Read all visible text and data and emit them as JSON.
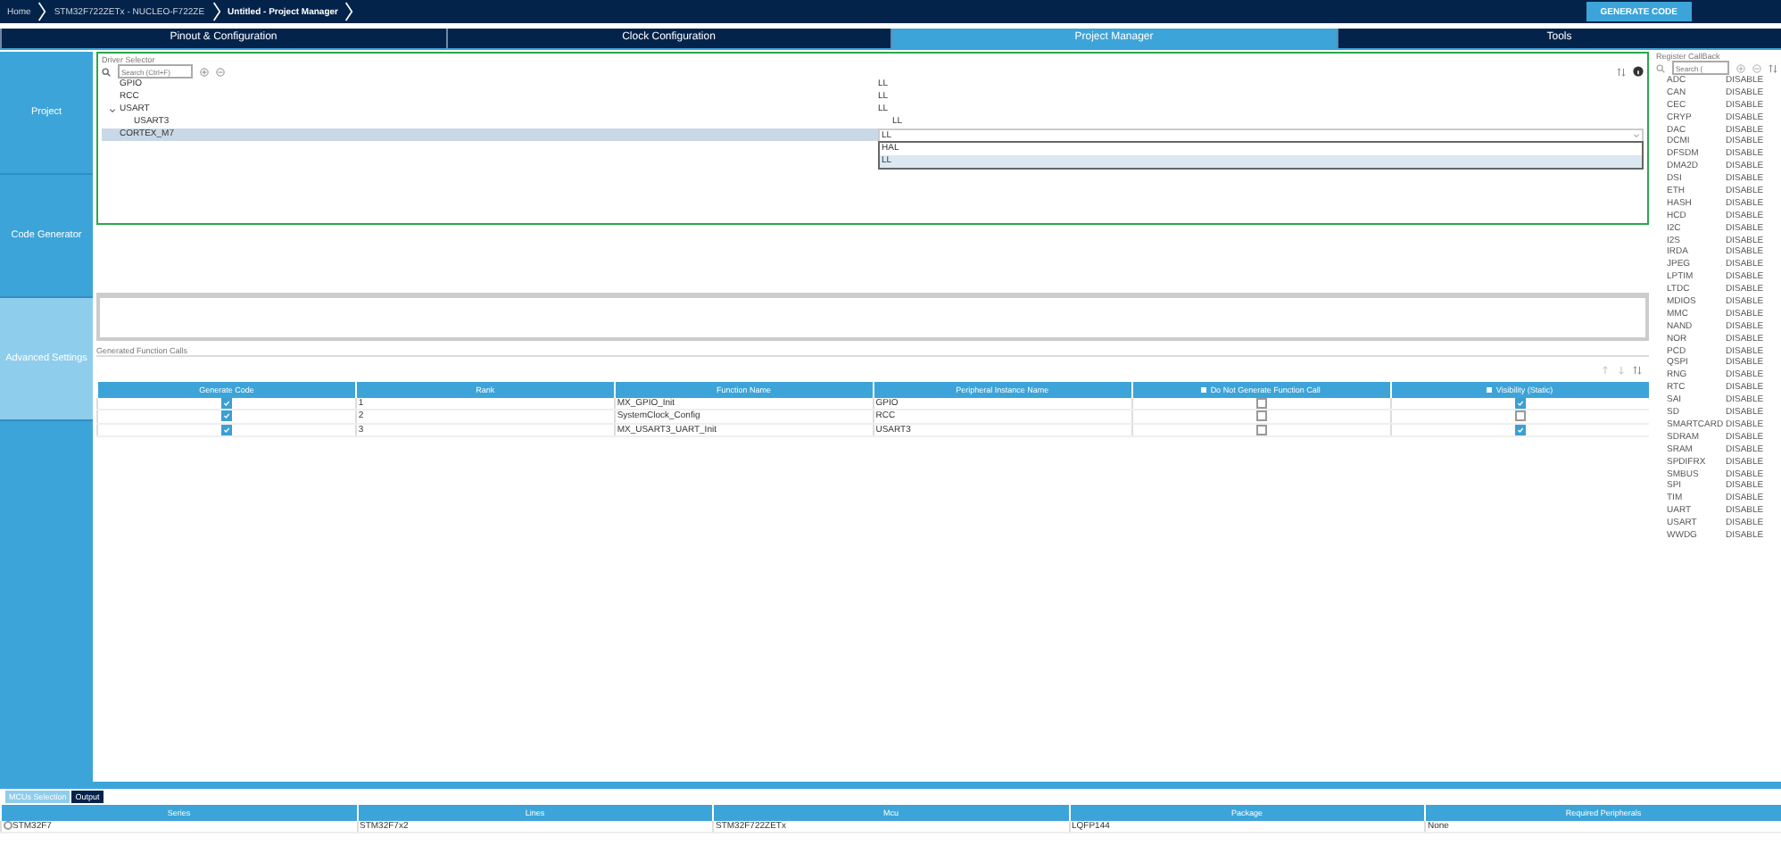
{
  "breadcrumb": [
    "Home",
    "STM32F722ZETx - NUCLEO-F722ZE",
    "Untitled - Project Manager"
  ],
  "generate_button": "GENERATE CODE",
  "tabs": [
    {
      "label": "Pinout & Configuration",
      "selected": false
    },
    {
      "label": "Clock Configuration",
      "selected": false
    },
    {
      "label": "Project Manager",
      "selected": true
    },
    {
      "label": "Tools",
      "selected": false
    }
  ],
  "sidebar": {
    "items": [
      {
        "label": "Project",
        "selected": false
      },
      {
        "label": "Code Generator",
        "selected": false
      },
      {
        "label": "Advanced Settings",
        "selected": true
      }
    ]
  },
  "driver_selector": {
    "title": "Driver Selector",
    "search_placeholder": "Search (Ctrl+F)",
    "rows": [
      {
        "name": "GPIO",
        "driver": "LL",
        "selected": false
      },
      {
        "name": "RCC",
        "driver": "LL",
        "selected": false
      },
      {
        "name": "USART",
        "driver": "LL",
        "selected": false,
        "expanded": true,
        "children": [
          {
            "name": "USART3",
            "driver": "LL",
            "selected": false
          }
        ]
      },
      {
        "name": "CORTEX_M7",
        "driver": "LL",
        "selected": true,
        "dropdown_open": true,
        "options": [
          {
            "label": "HAL",
            "selected": false
          },
          {
            "label": "LL",
            "selected": true
          }
        ]
      }
    ]
  },
  "function_calls": {
    "title": "Generated Function Calls",
    "columns": [
      {
        "label": "Generate Code",
        "checkbox": false
      },
      {
        "label": "Rank",
        "checkbox": false
      },
      {
        "label": "Function Name",
        "checkbox": false
      },
      {
        "label": "Peripheral Instance Name",
        "checkbox": false
      },
      {
        "label": "Do Not Generate Function Call",
        "checkbox": true
      },
      {
        "label": "Visibility (Static)",
        "checkbox": true
      }
    ],
    "rows": [
      {
        "generate": true,
        "rank": "1",
        "function": "MX_GPIO_Init",
        "instance": "GPIO",
        "do_not_generate": false,
        "static": true
      },
      {
        "generate": true,
        "rank": "2",
        "function": "SystemClock_Config",
        "instance": "RCC",
        "do_not_generate": false,
        "static": false
      },
      {
        "generate": true,
        "rank": "3",
        "function": "MX_USART3_UART_Init",
        "instance": "USART3",
        "do_not_generate": false,
        "static": true
      }
    ]
  },
  "register_callback": {
    "title": "Register CallBack",
    "search_placeholder": "Search (",
    "rows": [
      {
        "name": "ADC",
        "value": "DISABLE"
      },
      {
        "name": "CAN",
        "value": "DISABLE"
      },
      {
        "name": "CEC",
        "value": "DISABLE"
      },
      {
        "name": "CRYP",
        "value": "DISABLE"
      },
      {
        "name": "DAC",
        "value": "DISABLE"
      },
      {
        "name": "DCMI",
        "value": "DISABLE"
      },
      {
        "name": "DFSDM",
        "value": "DISABLE"
      },
      {
        "name": "DMA2D",
        "value": "DISABLE"
      },
      {
        "name": "DSI",
        "value": "DISABLE"
      },
      {
        "name": "ETH",
        "value": "DISABLE"
      },
      {
        "name": "HASH",
        "value": "DISABLE"
      },
      {
        "name": "HCD",
        "value": "DISABLE"
      },
      {
        "name": "I2C",
        "value": "DISABLE"
      },
      {
        "name": "I2S",
        "value": "DISABLE"
      },
      {
        "name": "IRDA",
        "value": "DISABLE"
      },
      {
        "name": "JPEG",
        "value": "DISABLE"
      },
      {
        "name": "LPTIM",
        "value": "DISABLE"
      },
      {
        "name": "LTDC",
        "value": "DISABLE"
      },
      {
        "name": "MDIOS",
        "value": "DISABLE"
      },
      {
        "name": "MMC",
        "value": "DISABLE"
      },
      {
        "name": "NAND",
        "value": "DISABLE"
      },
      {
        "name": "NOR",
        "value": "DISABLE"
      },
      {
        "name": "PCD",
        "value": "DISABLE"
      },
      {
        "name": "QSPI",
        "value": "DISABLE"
      },
      {
        "name": "RNG",
        "value": "DISABLE"
      },
      {
        "name": "RTC",
        "value": "DISABLE"
      },
      {
        "name": "SAI",
        "value": "DISABLE"
      },
      {
        "name": "SD",
        "value": "DISABLE"
      },
      {
        "name": "SMARTCARD",
        "value": "DISABLE"
      },
      {
        "name": "SDRAM",
        "value": "DISABLE"
      },
      {
        "name": "SRAM",
        "value": "DISABLE"
      },
      {
        "name": "SPDIFRX",
        "value": "DISABLE"
      },
      {
        "name": "SMBUS",
        "value": "DISABLE"
      },
      {
        "name": "SPI",
        "value": "DISABLE"
      },
      {
        "name": "TIM",
        "value": "DISABLE"
      },
      {
        "name": "UART",
        "value": "DISABLE"
      },
      {
        "name": "USART",
        "value": "DISABLE"
      },
      {
        "name": "WWDG",
        "value": "DISABLE"
      }
    ]
  },
  "bottom": {
    "tabs": [
      {
        "label": "MCUs Selection",
        "selected": true
      },
      {
        "label": "Output",
        "selected": false
      }
    ],
    "columns": [
      "Series",
      "Lines",
      "Mcu",
      "Package",
      "Required Peripherals"
    ],
    "rows": [
      {
        "cells": [
          "STM32F7",
          "STM32F7x2",
          "STM32F722ZETx",
          "LQFP144",
          "None"
        ]
      }
    ]
  }
}
